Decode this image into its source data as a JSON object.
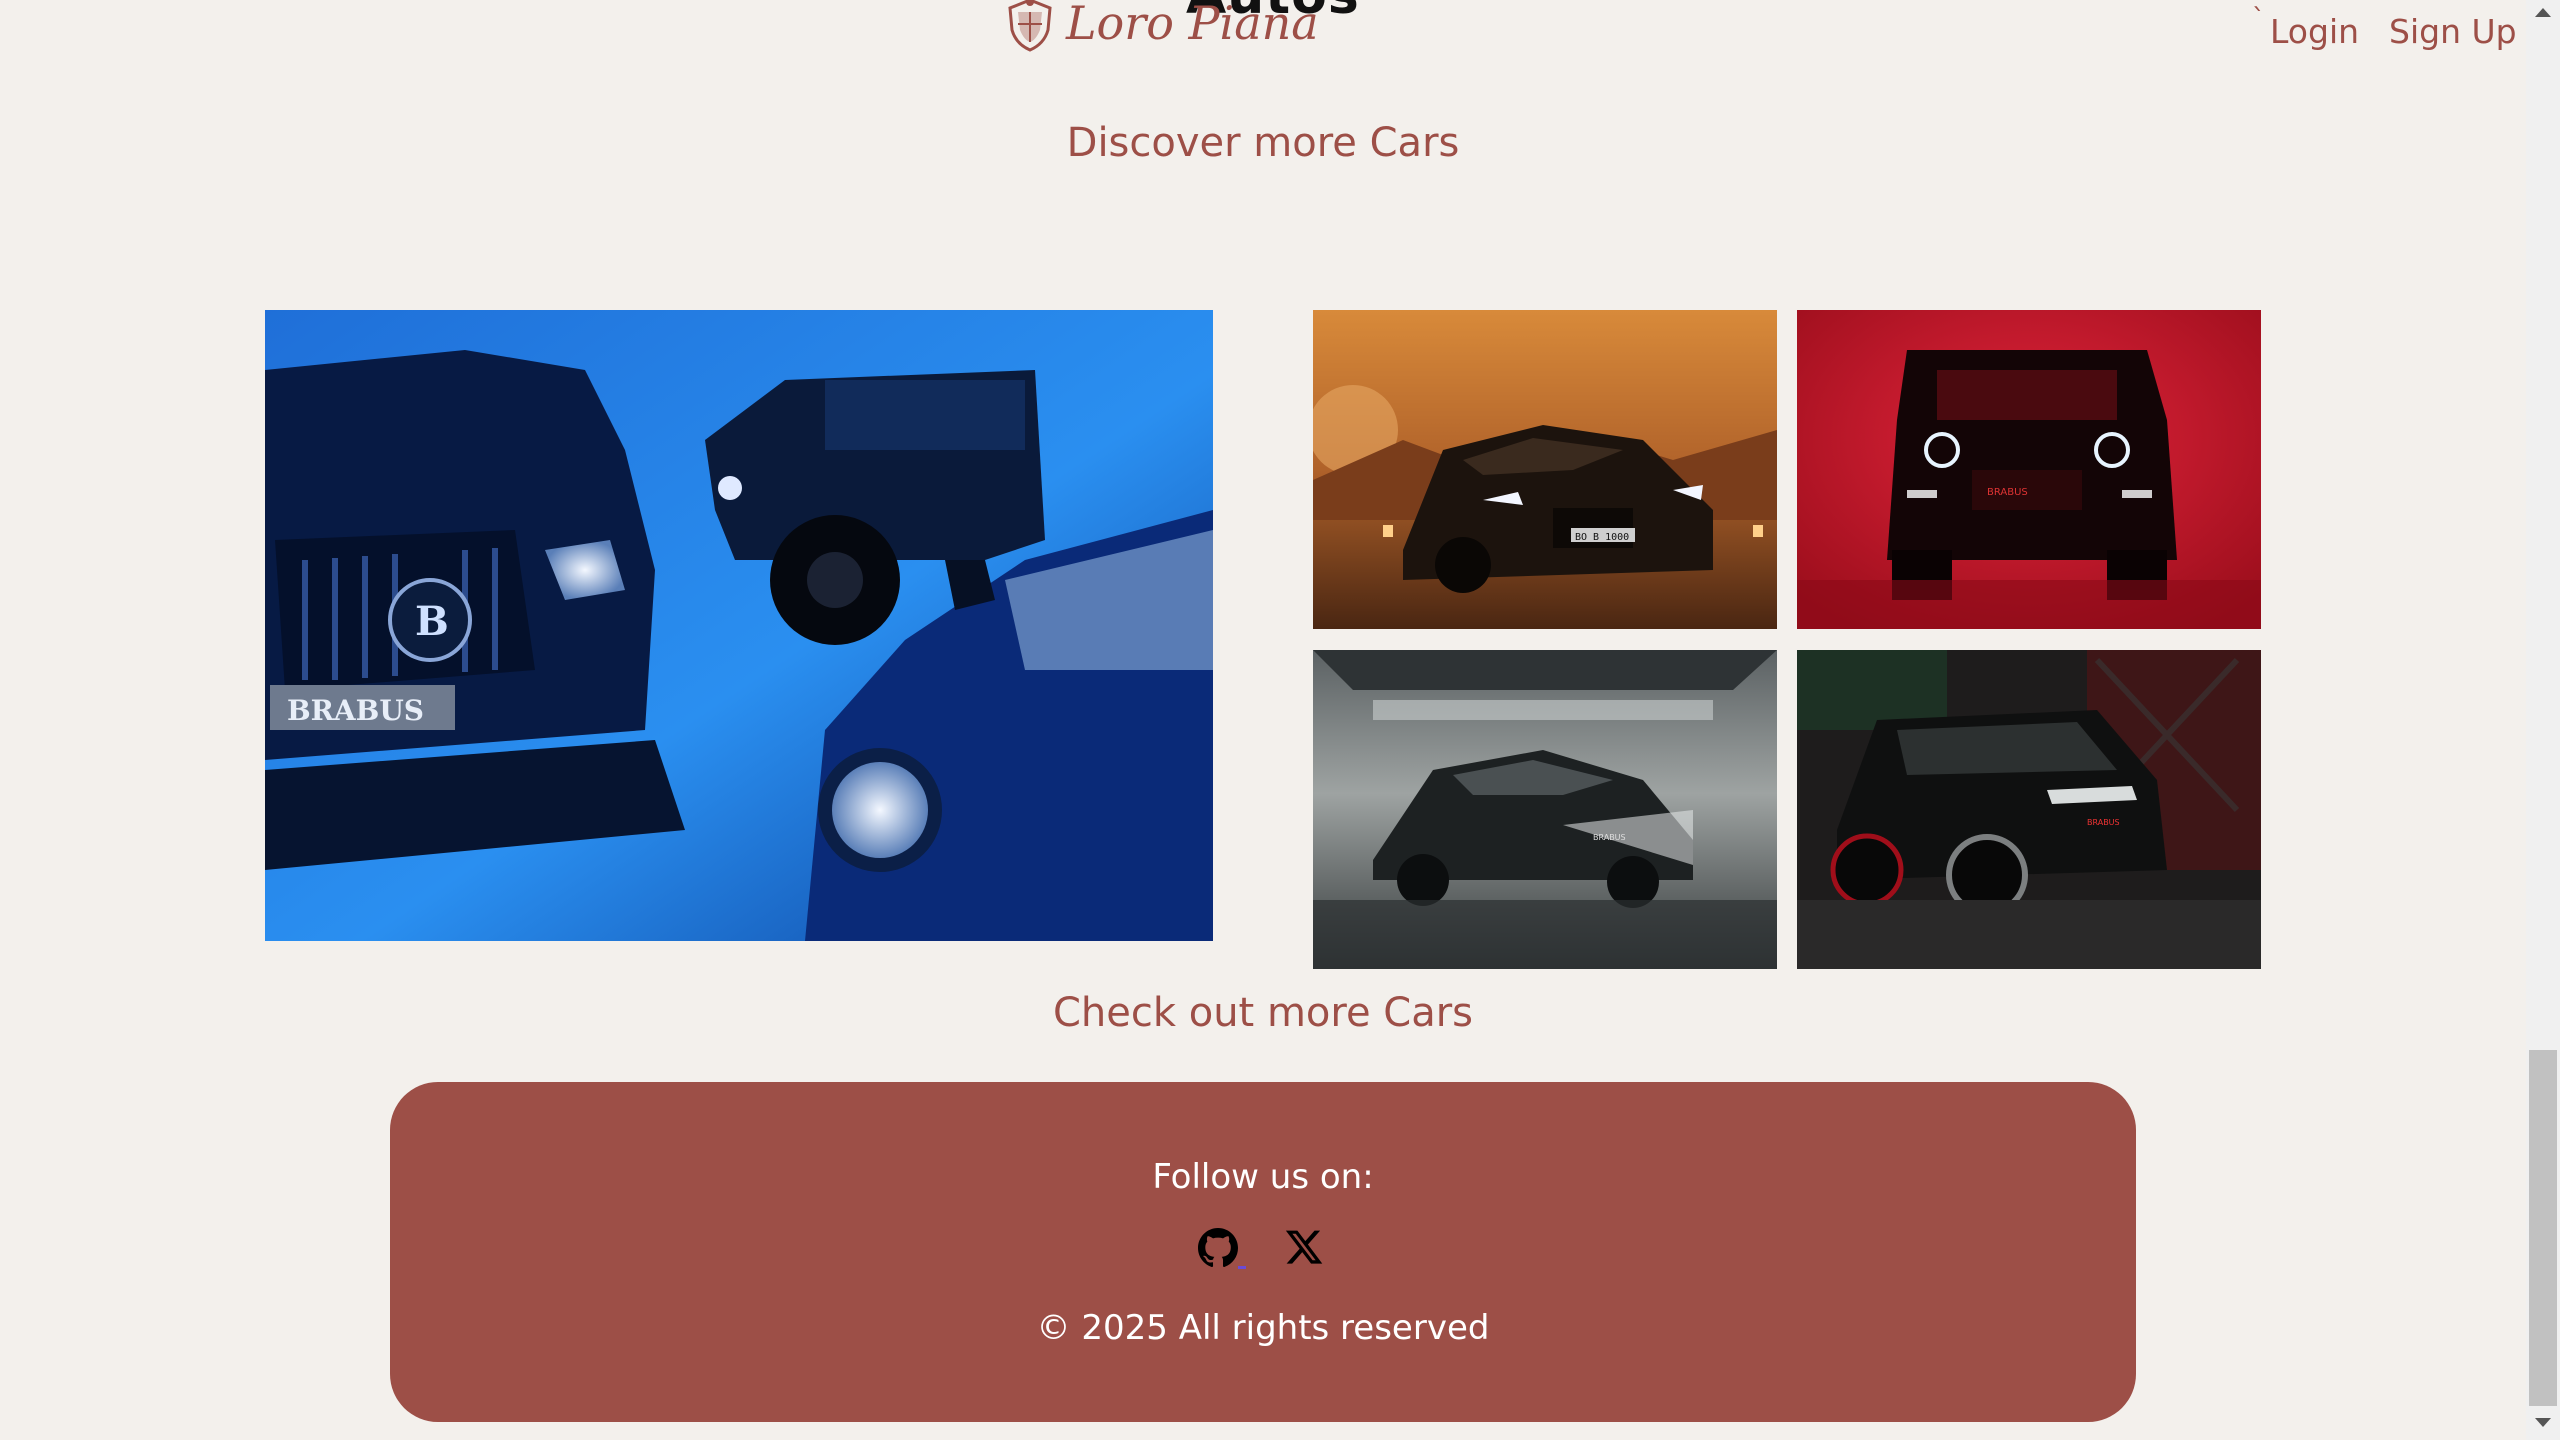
{
  "header": {
    "brand_title": "Autos",
    "logo_text": "Loro Piana",
    "tick_mark": "`",
    "login_label": "Login",
    "signup_label": "Sign Up"
  },
  "gallery": {
    "heading": "Discover more Cars",
    "main_image": {
      "plate_text": "BRABUS"
    },
    "thumbnails": [
      {
        "plate_text": "BO B 1000"
      },
      {
        "plate_text": "BRABUS"
      },
      {
        "plate_text": "BRABUS"
      },
      {
        "plate_text": "BRABUS"
      }
    ],
    "checkout_link": "Check out more Cars"
  },
  "footer": {
    "follow_label": "Follow us on:",
    "social_icons": [
      "github-icon",
      "x-icon"
    ],
    "copyright": "© 2025 All rights reserved"
  },
  "colors": {
    "page_background": "#f3f0ec",
    "accent": "#9d4f47",
    "footer_text": "#ffffff"
  }
}
